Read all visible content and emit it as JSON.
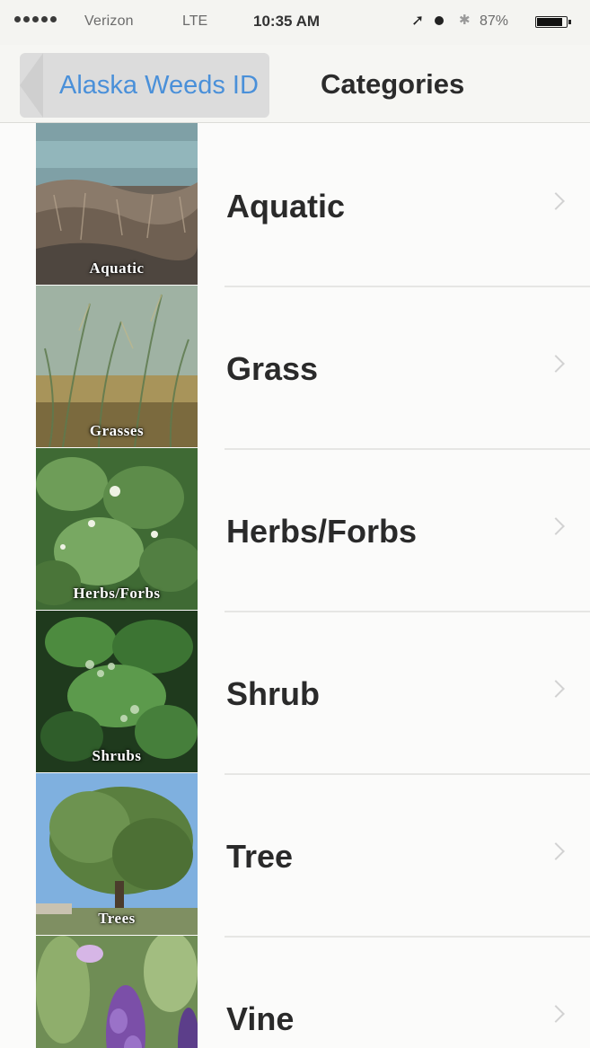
{
  "status_bar": {
    "carrier": "Verizon",
    "network": "LTE",
    "time": "10:35 AM",
    "battery_percent": "87%",
    "icons": [
      "signal-dots-icon",
      "location-arrow-icon",
      "alarm-icon",
      "bluetooth-icon",
      "battery-icon"
    ]
  },
  "nav": {
    "back_label": "Alaska Weeds ID",
    "title": "Categories"
  },
  "categories": [
    {
      "label": "Aquatic",
      "thumb_caption": "Aquatic"
    },
    {
      "label": "Grass",
      "thumb_caption": "Grasses"
    },
    {
      "label": "Herbs/Forbs",
      "thumb_caption": "Herbs/Forbs"
    },
    {
      "label": "Shrub",
      "thumb_caption": "Shrubs"
    },
    {
      "label": "Tree",
      "thumb_caption": "Trees"
    },
    {
      "label": "Vine",
      "thumb_caption": ""
    }
  ],
  "colors": {
    "link_blue": "#4a90d9",
    "label_text": "#2a2a2a",
    "background": "#fbfbfa"
  }
}
